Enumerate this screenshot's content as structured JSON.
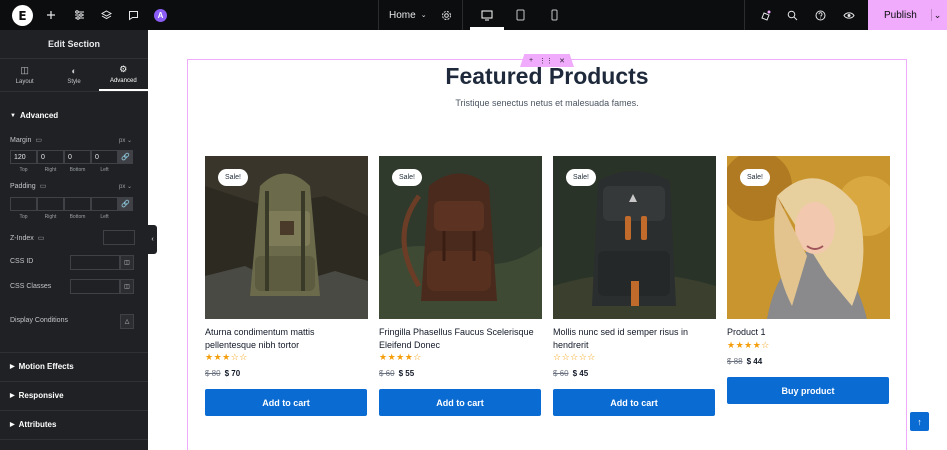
{
  "topbar": {
    "logo_text": "E",
    "ai_badge": "A",
    "page_select": "Home",
    "publish_label": "Publish"
  },
  "sidebar": {
    "title": "Edit Section",
    "tabs": [
      {
        "label": "Layout",
        "icon": "layout-icon"
      },
      {
        "label": "Style",
        "icon": "style-icon"
      },
      {
        "label": "Advanced",
        "icon": "gear-icon",
        "active": true
      }
    ],
    "advanced_heading": "Advanced",
    "margin": {
      "label": "Margin",
      "unit": "px",
      "values": [
        "120",
        "0",
        "0",
        "0"
      ],
      "sides": [
        "Top",
        "Right",
        "Bottom",
        "Left"
      ]
    },
    "padding": {
      "label": "Padding",
      "unit": "px",
      "values": [
        "",
        "",
        "",
        ""
      ],
      "sides": [
        "Top",
        "Right",
        "Bottom",
        "Left"
      ]
    },
    "z_index_label": "Z-Index",
    "css_id_label": "CSS ID",
    "css_classes_label": "CSS Classes",
    "display_conditions_label": "Display Conditions",
    "sections": [
      "Motion Effects",
      "Responsive",
      "Attributes"
    ]
  },
  "canvas": {
    "heading": "Featured Products",
    "subheading": "Tristique senectus netus et malesuada fames.",
    "products": [
      {
        "sale": "Sale!",
        "title": "Aturna condimentum mattis pellentesque nibh tortor",
        "rating": 3,
        "stars": "★★★☆☆",
        "old_price": "$ 80",
        "new_price": "$ 70",
        "button": "Add to cart"
      },
      {
        "sale": "Sale!",
        "title": "Fringilla Phasellus Faucus Scelerisque Eleifend Donec",
        "rating": 4,
        "stars": "★★★★☆",
        "old_price": "$ 60",
        "new_price": "$ 55",
        "button": "Add to cart"
      },
      {
        "sale": "Sale!",
        "title": "Mollis nunc sed id semper risus in hendrerit",
        "rating": 0,
        "stars": "☆☆☆☆☆",
        "old_price": "$ 60",
        "new_price": "$ 45",
        "button": "Add to cart"
      },
      {
        "sale": "Sale!",
        "title": "Product 1",
        "rating": 4,
        "stars": "★★★★☆",
        "old_price": "$ 88",
        "new_price": "$ 44",
        "button": "Buy product"
      }
    ]
  },
  "colors": {
    "accent": "#0a6bd3",
    "publish": "#f0abfc",
    "sidebar_bg": "#1f2124",
    "topbar_bg": "#0c0d0e",
    "star": "#f59e0b"
  }
}
